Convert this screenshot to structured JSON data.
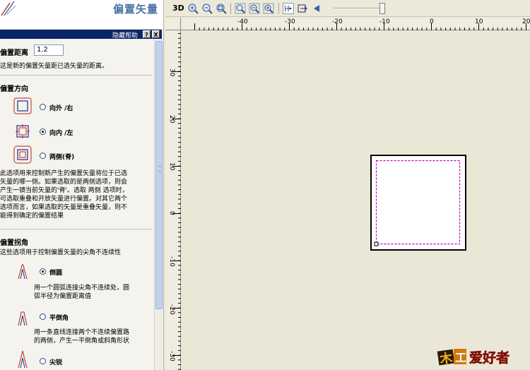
{
  "panel": {
    "title": "偏置矢量",
    "helpbar": {
      "hide_help": "隐藏帮助",
      "help_btn": "?",
      "close_btn": "X"
    },
    "offset_distance": {
      "label": "偏置距离",
      "value": "1.2",
      "desc": "这是新的偏置矢量距已选矢量的距离。"
    },
    "offset_direction": {
      "heading": "偏置方向",
      "options": [
        {
          "label": "向外  /右",
          "selected": false
        },
        {
          "label": "向内  /左",
          "selected": true
        },
        {
          "label": "两侧(脊)",
          "selected": false
        }
      ],
      "desc_lines": [
        "此选项用来控制新产生的偏置矢量将位于已选",
        "矢量的哪一侧。如果选取的是两侧选项，则会",
        "产生一镜当前矢量的'脊'。选取 两侧 选项时，",
        "可选取重叠和开放矢量进行偏置。对其它两个",
        "选项而言，如果选取的矢量是重叠矢量，则不",
        "能得到确定的偏置结果"
      ]
    },
    "offset_corner": {
      "heading": "偏置拐角",
      "desc": "这些选项用于控制偏置矢量的尖角不连续性",
      "options": [
        {
          "label": "倒圆",
          "selected": true,
          "desc_lines": [
            "用一个圆弧连接尖角不连续处，圆",
            "弧半径为偏置距离值"
          ]
        },
        {
          "label": "平倒角",
          "selected": false,
          "desc_lines": [
            "用一条直线连接两个不连续偏置路",
            "的两侧，产生一平倒角或斜角形状"
          ]
        },
        {
          "label": "尖锐",
          "selected": false
        }
      ]
    }
  },
  "toolbar": {
    "view3d": "3D"
  },
  "ruler": {
    "h_ticks": [
      "-40",
      "-30",
      "-20",
      "-10",
      "0",
      "10",
      "20"
    ],
    "v_ticks": [
      "30",
      "20",
      "10",
      "0",
      "-10",
      "-20",
      "-30"
    ]
  },
  "watermark": {
    "text": "爱好者"
  },
  "colors": {
    "accent": "#0a246a",
    "selection": "#c000c0",
    "title": "#4a6fa5"
  }
}
